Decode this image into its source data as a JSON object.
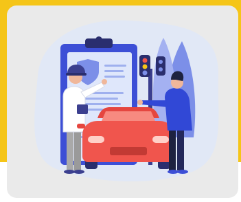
{
  "illustration": {
    "subject": "",
    "colors": {
      "accent_yellow": "#f5c518",
      "card_bg": "#eaeaea",
      "blob_bg": "#e1e8f6",
      "clipboard_blue": "#3d4fd6",
      "paper_light": "#dfe7fb",
      "car_red": "#f0554d",
      "car_dark": "#3b3f8f",
      "tree_blue": "#7c8fe8",
      "jacket_blue": "#3148d6",
      "officer_shirt": "#ffffff",
      "officer_pants": "#a9a9a9",
      "skin": "#f0b79a",
      "hair_dark": "#1e2240"
    }
  }
}
